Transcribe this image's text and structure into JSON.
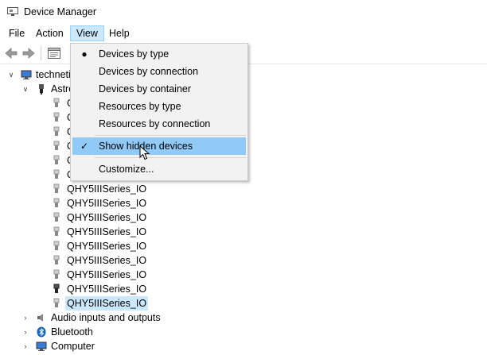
{
  "window": {
    "title": "Device Manager",
    "icon": "device-manager-icon"
  },
  "menu": {
    "file": "File",
    "action": "Action",
    "view": "View",
    "help": "Help"
  },
  "toolbar": {
    "buttons": [
      "back-arrow-icon",
      "forward-arrow-icon",
      "properties-icon"
    ]
  },
  "tree": {
    "root": "technetium",
    "astro_category": "Astronomy cameras",
    "astro_child_partial": [
      "Q",
      "Q",
      "Q",
      "Q",
      "Q",
      "Q"
    ],
    "astro_children": [
      "QHY5IIISeries_IO",
      "QHY5IIISeries_IO",
      "QHY5IIISeries_IO",
      "QHY5IIISeries_IO",
      "QHY5IIISeries_IO",
      "QHY5IIISeries_IO",
      "QHY5IIISeries_IO",
      "QHY5IIISeries_IO",
      "QHY5IIISeries_IO"
    ],
    "audio": "Audio inputs and outputs",
    "bluetooth": "Bluetooth",
    "computer": "Computer"
  },
  "view_menu": {
    "devices_by_type": "Devices by type",
    "devices_by_connection": "Devices by connection",
    "devices_by_container": "Devices by container",
    "resources_by_type": "Resources by type",
    "resources_by_connection": "Resources by connection",
    "show_hidden_devices": "Show hidden devices",
    "customize": "Customize..."
  },
  "colors": {
    "selection": "#cce8ff",
    "menu_highlight": "#91c9f7",
    "menu_bg": "#f2f2f2"
  }
}
